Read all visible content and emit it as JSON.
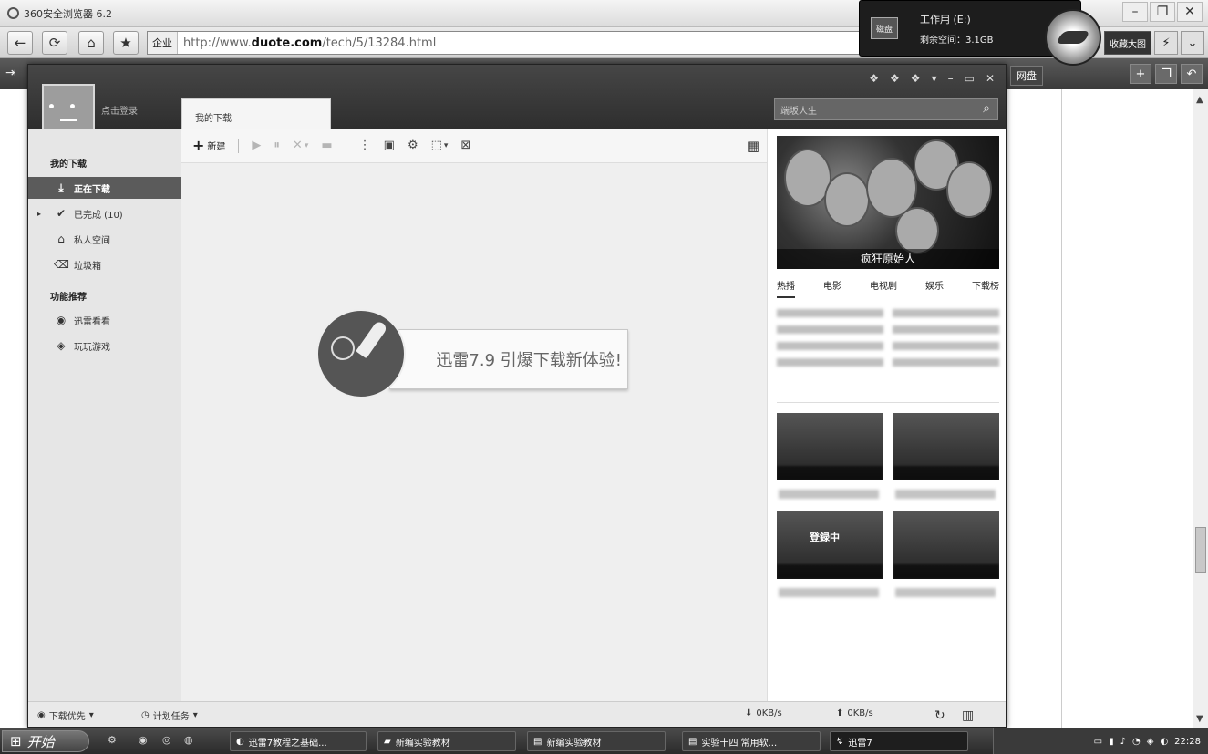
{
  "browser": {
    "title": "360安全浏览器 6.2",
    "address": {
      "zone": "企业",
      "url_prefix": "http://www.",
      "url_domain": "duote.com",
      "url_suffix": "/tech/5/13284.html"
    },
    "nav": {
      "back": "←",
      "refresh": "⟳",
      "home": "⌂",
      "favorite": "★"
    },
    "right_badge": "收藏大图",
    "tab_chip": "网盘",
    "window_buttons": [
      "–",
      "❐",
      "✕"
    ]
  },
  "disk_popup": {
    "icon_label": "磁盘",
    "line1": "工作用 (E:)",
    "line2": "剩余空间：3.1GB"
  },
  "xunlei": {
    "window_buttons": [
      "❖",
      "❖",
      "❖",
      "▾",
      "–",
      "▭",
      "✕"
    ],
    "login_text": "点击登录",
    "tab": "我的下载",
    "search_placeholder": "端坂人生",
    "sidebar": {
      "section_downloads": "我的下载",
      "items": [
        {
          "icon": "⤓",
          "label": "正在下载"
        },
        {
          "icon": "✔",
          "label": "已完成 (10)"
        },
        {
          "icon": "⌂",
          "label": "私人空间"
        },
        {
          "icon": "⌫",
          "label": "垃圾箱"
        }
      ],
      "section_features": "功能推荐",
      "features": [
        {
          "icon": "◉",
          "label": "迅雷看看"
        },
        {
          "icon": "◈",
          "label": "玩玩游戏"
        }
      ]
    },
    "toolbar": {
      "new_label": "新建",
      "icons": [
        "▶",
        "⏸",
        "✕",
        "▾",
        "▬",
        "⋮",
        "▣",
        "⚙",
        "⬚",
        "▾",
        "⊠"
      ],
      "grid": "▦"
    },
    "promo_text": "迅雷7.9 引爆下载新体验!",
    "right_panel": {
      "poster_caption": "疯狂原始人",
      "tabs": [
        "热播",
        "电影",
        "电视剧",
        "娱乐",
        "下载榜"
      ],
      "thumb_overlay_text": "登録中"
    },
    "status": {
      "priority": "下载优先",
      "schedule": "计划任务",
      "download_speed": "0KB/s",
      "upload_speed": "0KB/s"
    }
  },
  "taskbar": {
    "start": "开始",
    "buttons": [
      "迅雷7教程之基础...",
      "新编实验教材",
      "新编实验教材",
      "实验十四 常用软...",
      "迅雷7"
    ],
    "clock": "22:28"
  }
}
